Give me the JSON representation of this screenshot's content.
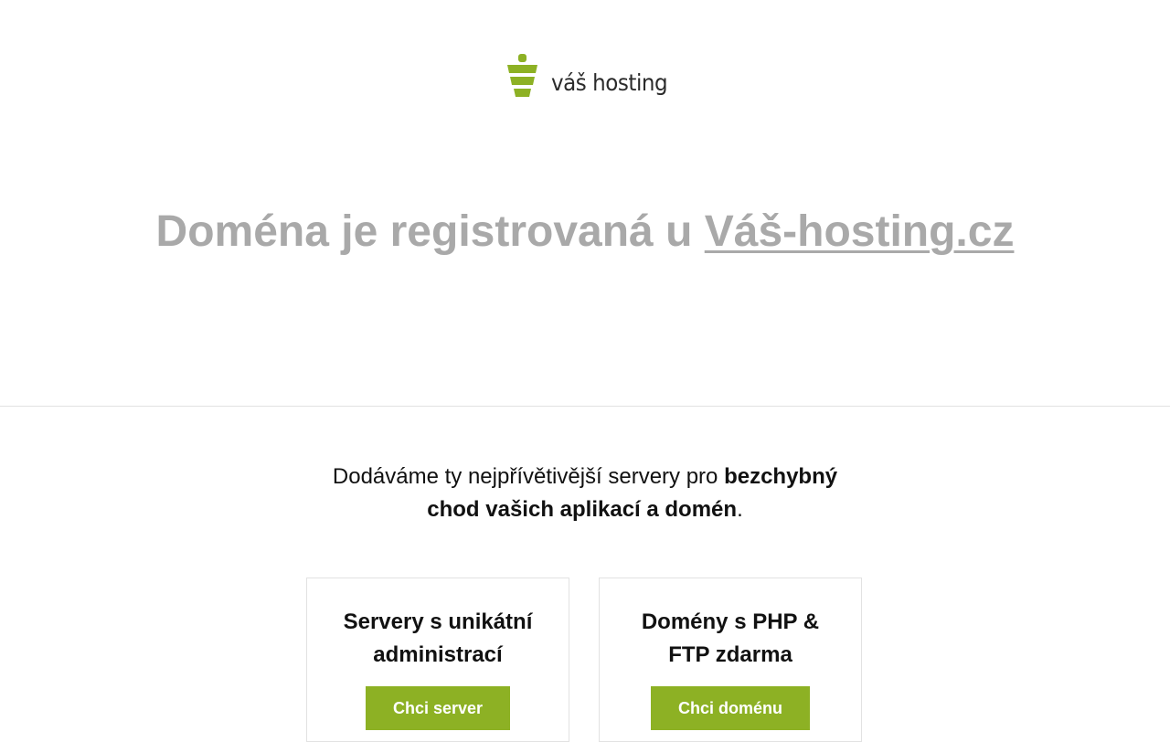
{
  "logo": {
    "text": "váš hosting",
    "icon": "vas-hosting-logo-icon"
  },
  "headline": {
    "prefix": "Doména je registrovaná u ",
    "link_text": "Váš-hosting.cz"
  },
  "intro": {
    "text_plain": "Dodáváme ty nejpřívětivější servery pro ",
    "text_bold": "bezchybný chod vašich aplikací a domén",
    "text_end": "."
  },
  "cards": [
    {
      "title": "Servery s unikátní administrací",
      "button": "Chci server"
    },
    {
      "title": "Domény s PHP & FTP zdarma",
      "button": "Chci doménu"
    }
  ],
  "colors": {
    "accent": "#8db124",
    "headline": "#a9a9a9",
    "logo_text": "#2b2b2b"
  }
}
